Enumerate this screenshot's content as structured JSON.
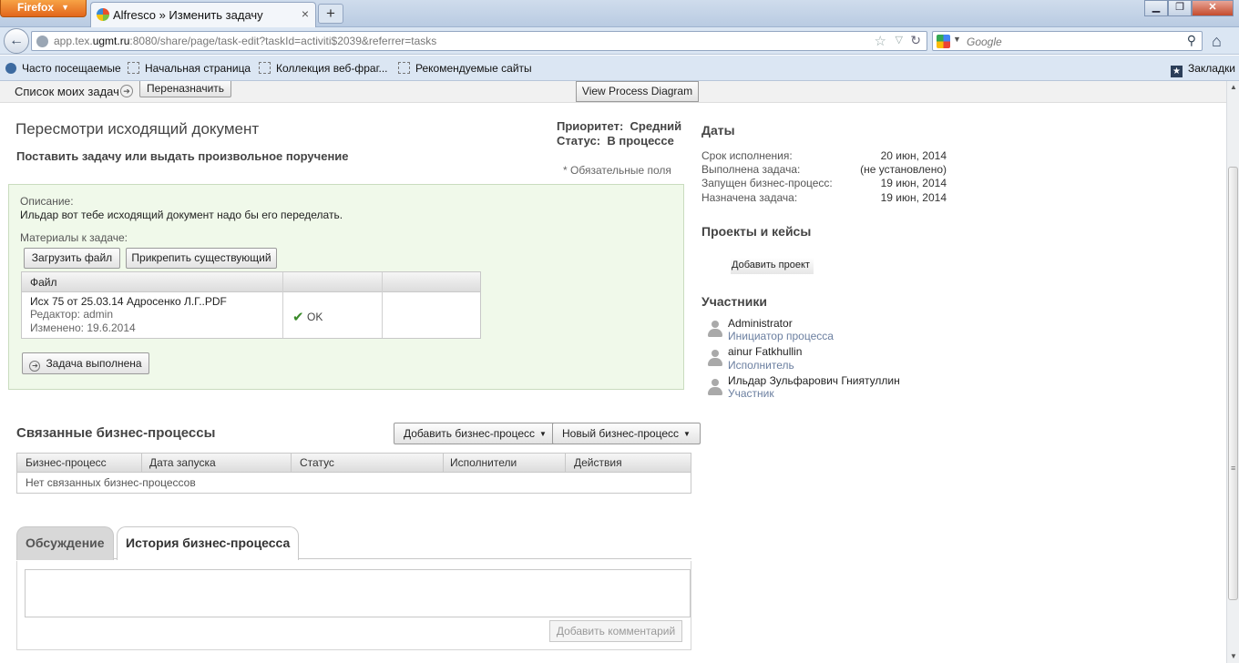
{
  "browser": {
    "app_button": "Firefox",
    "tab_title": "Alfresco » Изменить задачу",
    "url_host_prefix": "app.tex.",
    "url_host_main": "ugmt.ru",
    "url_rest": ":8080/share/page/task-edit?taskId=activiti$2039&referrer=tasks",
    "search_placeholder": "Google",
    "bookmarks": [
      "Часто посещаемые",
      "Начальная страница",
      "Коллекция веб-фраг...",
      "Рекомендуемые сайты"
    ],
    "bookmarks_menu": "Закладки"
  },
  "topbar": {
    "breadcrumb": "Список моих задач",
    "reassign_button": "Переназначить",
    "diagram_button": "View Process Diagram"
  },
  "task": {
    "title": "Пересмотри исходящий документ",
    "type": "Поставить задачу или выдать произвольное поручение",
    "priority_label": "Приоритет:",
    "priority_value": "Средний",
    "status_label": "Статус:",
    "status_value": "В процессе",
    "required_note": "* Обязательные поля"
  },
  "form": {
    "description_label": "Описание:",
    "description_value": "Ильдар вот тебе исходящий документ надо бы его переделать.",
    "attachments_label": "Материалы к задаче:",
    "upload_button": "Загрузить файл",
    "attach_button": "Прикрепить существующий",
    "file_table_header": "Файл",
    "file": {
      "name": "Исх 75 от 25.03.14 Адросенко Л.Г..PDF",
      "editor": "Редактор: admin",
      "modified": "Изменено: 19.6.2014",
      "status": "OK"
    },
    "done_button": "Задача выполнена"
  },
  "workflows": {
    "heading": "Связанные бизнес-процессы",
    "add_button": "Добавить бизнес-процесс",
    "new_button": "Новый бизнес-процесс",
    "columns": [
      "Бизнес-процесс",
      "Дата запуска",
      "Статус",
      "Исполнители",
      "Действия"
    ],
    "empty_text": "Нет связанных бизнес-процессов"
  },
  "comments": {
    "tab_discussion": "Обсуждение",
    "tab_history": "История бизнес-процесса",
    "add_button": "Добавить комментарий"
  },
  "sidebar": {
    "dates_heading": "Даты",
    "dates": [
      {
        "label": "Срок исполнения:",
        "value": "20 июн, 2014"
      },
      {
        "label": "Выполнена задача:",
        "value": "(не установлено)"
      },
      {
        "label": "Запущен бизнес-процесс:",
        "value": "19 июн, 2014"
      },
      {
        "label": "Назначена задача:",
        "value": "19 июн, 2014"
      }
    ],
    "projects_heading": "Проекты и кейсы",
    "add_project": "Добавить проект",
    "participants_heading": "Участники",
    "participants": [
      {
        "name": "Administrator",
        "role": "Инициатор процесса"
      },
      {
        "name": "ainur Fatkhullin",
        "role": "Исполнитель"
      },
      {
        "name": "Ильдар Зульфарович Гниятуллин",
        "role": "Участник"
      }
    ]
  }
}
